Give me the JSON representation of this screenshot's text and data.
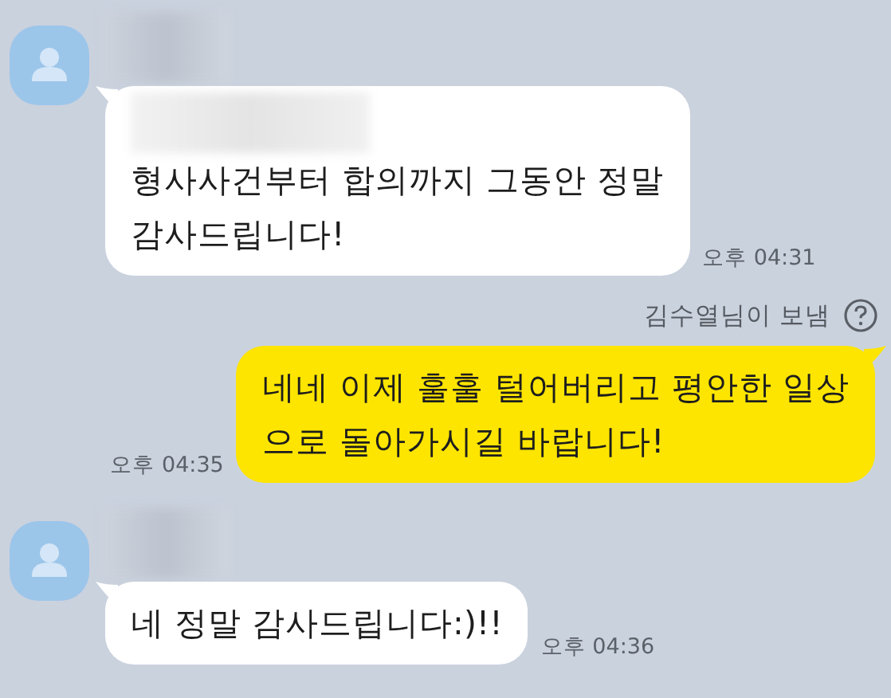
{
  "messages": [
    {
      "kind": "incoming",
      "name_hidden": true,
      "quote_hidden": true,
      "lines": [
        "형사사건부터 합의까지 그동안 정말",
        "감사드립니다!"
      ],
      "time": "오후 04:31"
    },
    {
      "kind": "outgoing",
      "sender_note": "김수열님이 보냄",
      "lines": [
        "네네 이제 훌훌 털어버리고 평안한 일상",
        "으로 돌아가시길 바랍니다!"
      ],
      "time": "오후 04:35"
    },
    {
      "kind": "incoming",
      "name_hidden": true,
      "quote_hidden": false,
      "lines": [
        "네 정말 감사드립니다:)!!"
      ],
      "time": "오후 04:36"
    }
  ]
}
